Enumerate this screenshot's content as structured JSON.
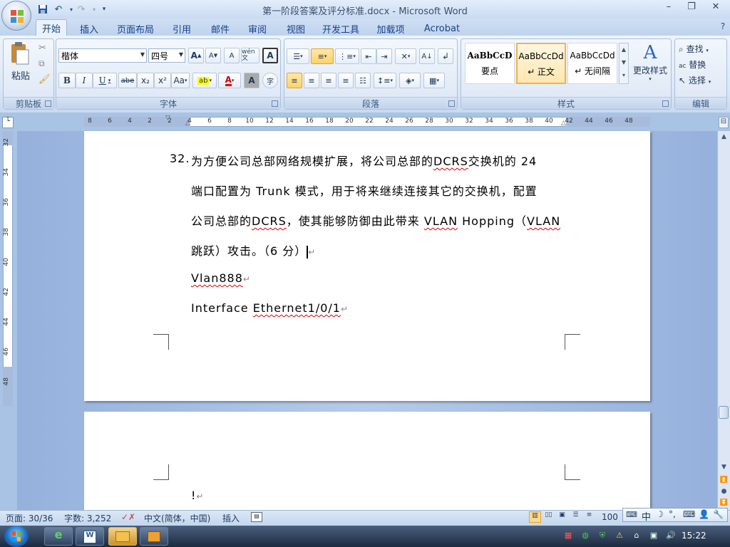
{
  "window": {
    "title": "第一阶段答案及评分标准.docx - Microsoft Word"
  },
  "qat": {
    "save": "save-icon",
    "undo": "undo-icon",
    "redo": "redo-icon"
  },
  "tabs": [
    "开始",
    "插入",
    "页面布局",
    "引用",
    "邮件",
    "审阅",
    "视图",
    "开发工具",
    "加载项",
    "Acrobat"
  ],
  "active_tab": "开始",
  "ribbon": {
    "clipboard": {
      "label": "剪贴板",
      "paste": "粘贴"
    },
    "font": {
      "label": "字体",
      "font_name": "楷体",
      "font_size": "四号",
      "b": "B",
      "i": "I",
      "u": "U",
      "strike": "abe",
      "sub": "x₂",
      "sup": "x²",
      "case": "Aa",
      "grow": "A",
      "shrink": "A",
      "clear": "A",
      "char_border": "A",
      "char_shade": "A",
      "enclose": "字",
      "phonetic": "wén 文"
    },
    "paragraph": {
      "label": "段落"
    },
    "styles": {
      "label": "样式",
      "items": [
        {
          "preview": "AaBbCcD",
          "name": "要点"
        },
        {
          "preview": "AaBbCcDd",
          "name": "↵ 正文"
        },
        {
          "preview": "AaBbCcDd",
          "name": "↵ 无间隔"
        }
      ],
      "change": "更改样式"
    },
    "editing": {
      "label": "编辑",
      "find": "查找",
      "replace": "替换",
      "select": "选择"
    }
  },
  "ruler": {
    "numbers": [
      "8",
      "6",
      "4",
      "2",
      "2",
      "4",
      "6",
      "8",
      "10",
      "12",
      "14",
      "16",
      "18",
      "20",
      "22",
      "24",
      "26",
      "28",
      "30",
      "32",
      "34",
      "36",
      "38",
      "40",
      "42",
      "44",
      "46",
      "48"
    ],
    "vnumbers": [
      "32",
      "34",
      "36",
      "38",
      "40",
      "42",
      "44",
      "46",
      "48"
    ]
  },
  "document": {
    "q_number": "32.",
    "para1": [
      "为方便公司总部网络规模扩展，将公司总部的",
      "DCRS",
      "交换机的 24",
      "端口配置为 Trunk 模式，用于将来继续连接其它的交换机，配置",
      "公司总部的",
      "DCRS",
      "，使其能够防御由此带来",
      "VLAN",
      "Hopping（",
      "VLAN",
      "跳跃）攻击。（6 分）"
    ],
    "line_vlan": "Vlan888",
    "line_iface_a": "Interface",
    "line_iface_b": "Ethernet1/0/1",
    "page2_text": "!",
    "para_mark": "↵"
  },
  "status": {
    "page": "页面: 30/36",
    "words": "字数: 3,252",
    "lang": "中文(简体，中国)",
    "mode": "插入",
    "zoom": "100"
  },
  "ime": {
    "label": "中"
  },
  "taskbar": {
    "clock": "15:22"
  },
  "colors": {
    "ribbon": "#dbe7f6",
    "doc_bg": "#a9c3e4",
    "squiggle": "#dd0000"
  }
}
